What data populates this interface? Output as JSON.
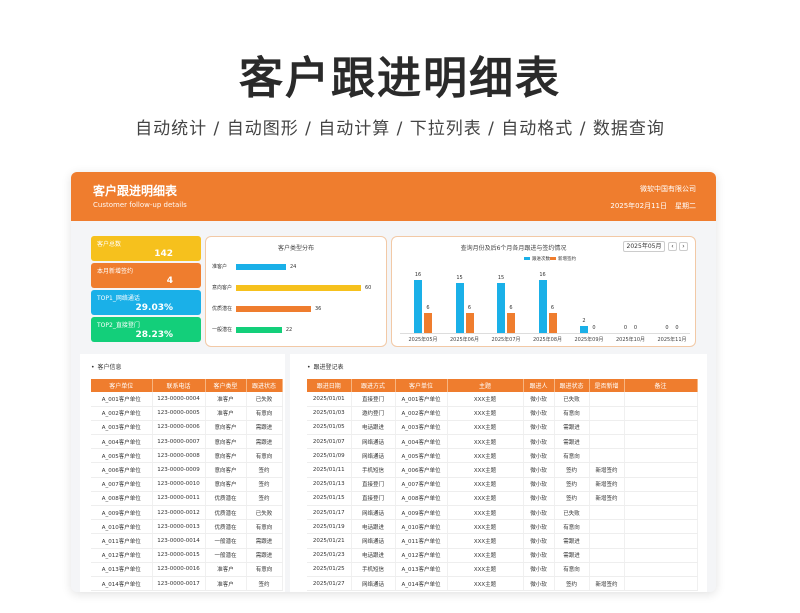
{
  "hero": {
    "title": "客户跟进明细表",
    "subtitle": "自动统计  /  自动图形  /  自动计算  /  下拉列表  /  自动格式  /  数据查询"
  },
  "header": {
    "title": "客户跟进明细表",
    "subtitle_en": "Customer follow-up details",
    "company": "微软中国有限公司",
    "date": "2025年02月11日",
    "weekday": "星期二"
  },
  "colors": {
    "orange": "#ef7d2e",
    "yellow": "#f6c11d",
    "blue": "#1ab0e8",
    "green": "#13cf7a"
  },
  "stats": [
    {
      "label": "客户总数",
      "value": "142",
      "color": "#f6c11d"
    },
    {
      "label": "本月新增签约",
      "value": "4",
      "color": "#ef7d2e"
    },
    {
      "label": "TOP1_网络通话",
      "value": "29.03%",
      "color": "#1ab0e8"
    },
    {
      "label": "TOP2_直接登门",
      "value": "28.23%",
      "color": "#13cf7a"
    }
  ],
  "type_chart": {
    "title": "客户类型分布",
    "max": 60,
    "items": [
      {
        "label": "准客户",
        "value": 24,
        "color": "#1ab0e8"
      },
      {
        "label": "意向客户",
        "value": 60,
        "color": "#f6c11d"
      },
      {
        "label": "优质潜在",
        "value": 36,
        "color": "#ef7d2e"
      },
      {
        "label": "一般潜在",
        "value": 22,
        "color": "#13cf7a"
      }
    ]
  },
  "chart_data": {
    "type": "bar",
    "title": "查询月份及后6个月各月跟进与签约情况",
    "selected_month": "2025年05月",
    "categories": [
      "2025年05月",
      "2025年06月",
      "2025年07月",
      "2025年08月",
      "2025年09月",
      "2025年10月",
      "2025年11月"
    ],
    "series": [
      {
        "name": "跟进次数",
        "color": "#1ab0e8",
        "values": [
          16,
          15,
          15,
          16,
          2,
          0,
          0
        ]
      },
      {
        "name": "新增签约",
        "color": "#ef7d2e",
        "values": [
          6,
          6,
          6,
          6,
          0,
          0,
          0
        ]
      }
    ],
    "ylim": [
      0,
      18
    ],
    "grid": false,
    "legend": "top-center"
  },
  "customers": {
    "title": "客户信息",
    "columns": [
      "客户单位",
      "联系电话",
      "客户类型",
      "跟进状态"
    ],
    "rows": [
      [
        "A_001客户单位",
        "123-0000-0004",
        "准客户",
        "已失败"
      ],
      [
        "A_002客户单位",
        "123-0000-0005",
        "准客户",
        "有意向"
      ],
      [
        "A_003客户单位",
        "123-0000-0006",
        "意向客户",
        "需跟进"
      ],
      [
        "A_004客户单位",
        "123-0000-0007",
        "意向客户",
        "需跟进"
      ],
      [
        "A_005客户单位",
        "123-0000-0008",
        "意向客户",
        "有意向"
      ],
      [
        "A_006客户单位",
        "123-0000-0009",
        "意向客户",
        "签约"
      ],
      [
        "A_007客户单位",
        "123-0000-0010",
        "意向客户",
        "签约"
      ],
      [
        "A_008客户单位",
        "123-0000-0011",
        "优质潜在",
        "签约"
      ],
      [
        "A_009客户单位",
        "123-0000-0012",
        "优质潜在",
        "已失败"
      ],
      [
        "A_010客户单位",
        "123-0000-0013",
        "优质潜在",
        "有意向"
      ],
      [
        "A_011客户单位",
        "123-0000-0014",
        "一般潜在",
        "需跟进"
      ],
      [
        "A_012客户单位",
        "123-0000-0015",
        "一般潜在",
        "需跟进"
      ],
      [
        "A_013客户单位",
        "123-0000-0016",
        "准客户",
        "有意向"
      ],
      [
        "A_014客户单位",
        "123-0000-0017",
        "准客户",
        "签约"
      ]
    ]
  },
  "followups": {
    "title": "跟进登记表",
    "columns": [
      "跟进日期",
      "跟进方式",
      "客户单位",
      "主题",
      "跟进人",
      "跟进状态",
      "是否新增",
      "备注"
    ],
    "rows": [
      [
        "2025/01/01",
        "直接登门",
        "A_001客户单位",
        "XXX主题",
        "微小软",
        "已失败",
        "",
        ""
      ],
      [
        "2025/01/03",
        "邀约登门",
        "A_002客户单位",
        "XXX主题",
        "微小软",
        "有意向",
        "",
        ""
      ],
      [
        "2025/01/05",
        "电话跟进",
        "A_003客户单位",
        "XXX主题",
        "微小软",
        "需跟进",
        "",
        ""
      ],
      [
        "2025/01/07",
        "网络通话",
        "A_004客户单位",
        "XXX主题",
        "微小软",
        "需跟进",
        "",
        ""
      ],
      [
        "2025/01/09",
        "网络通话",
        "A_005客户单位",
        "XXX主题",
        "微小软",
        "有意向",
        "",
        ""
      ],
      [
        "2025/01/11",
        "手机短信",
        "A_006客户单位",
        "XXX主题",
        "微小软",
        "签约",
        "新增签约",
        ""
      ],
      [
        "2025/01/13",
        "直接登门",
        "A_007客户单位",
        "XXX主题",
        "微小软",
        "签约",
        "新增签约",
        ""
      ],
      [
        "2025/01/15",
        "直接登门",
        "A_008客户单位",
        "XXX主题",
        "微小软",
        "签约",
        "新增签约",
        ""
      ],
      [
        "2025/01/17",
        "网络通话",
        "A_009客户单位",
        "XXX主题",
        "微小软",
        "已失败",
        "",
        ""
      ],
      [
        "2025/01/19",
        "电话跟进",
        "A_010客户单位",
        "XXX主题",
        "微小软",
        "有意向",
        "",
        ""
      ],
      [
        "2025/01/21",
        "网络通话",
        "A_011客户单位",
        "XXX主题",
        "微小软",
        "需跟进",
        "",
        ""
      ],
      [
        "2025/01/23",
        "电话跟进",
        "A_012客户单位",
        "XXX主题",
        "微小软",
        "需跟进",
        "",
        ""
      ],
      [
        "2025/01/25",
        "手机短信",
        "A_013客户单位",
        "XXX主题",
        "微小软",
        "有意向",
        "",
        ""
      ],
      [
        "2025/01/27",
        "网络通话",
        "A_014客户单位",
        "XXX主题",
        "微小软",
        "签约",
        "新增签约",
        ""
      ]
    ]
  }
}
